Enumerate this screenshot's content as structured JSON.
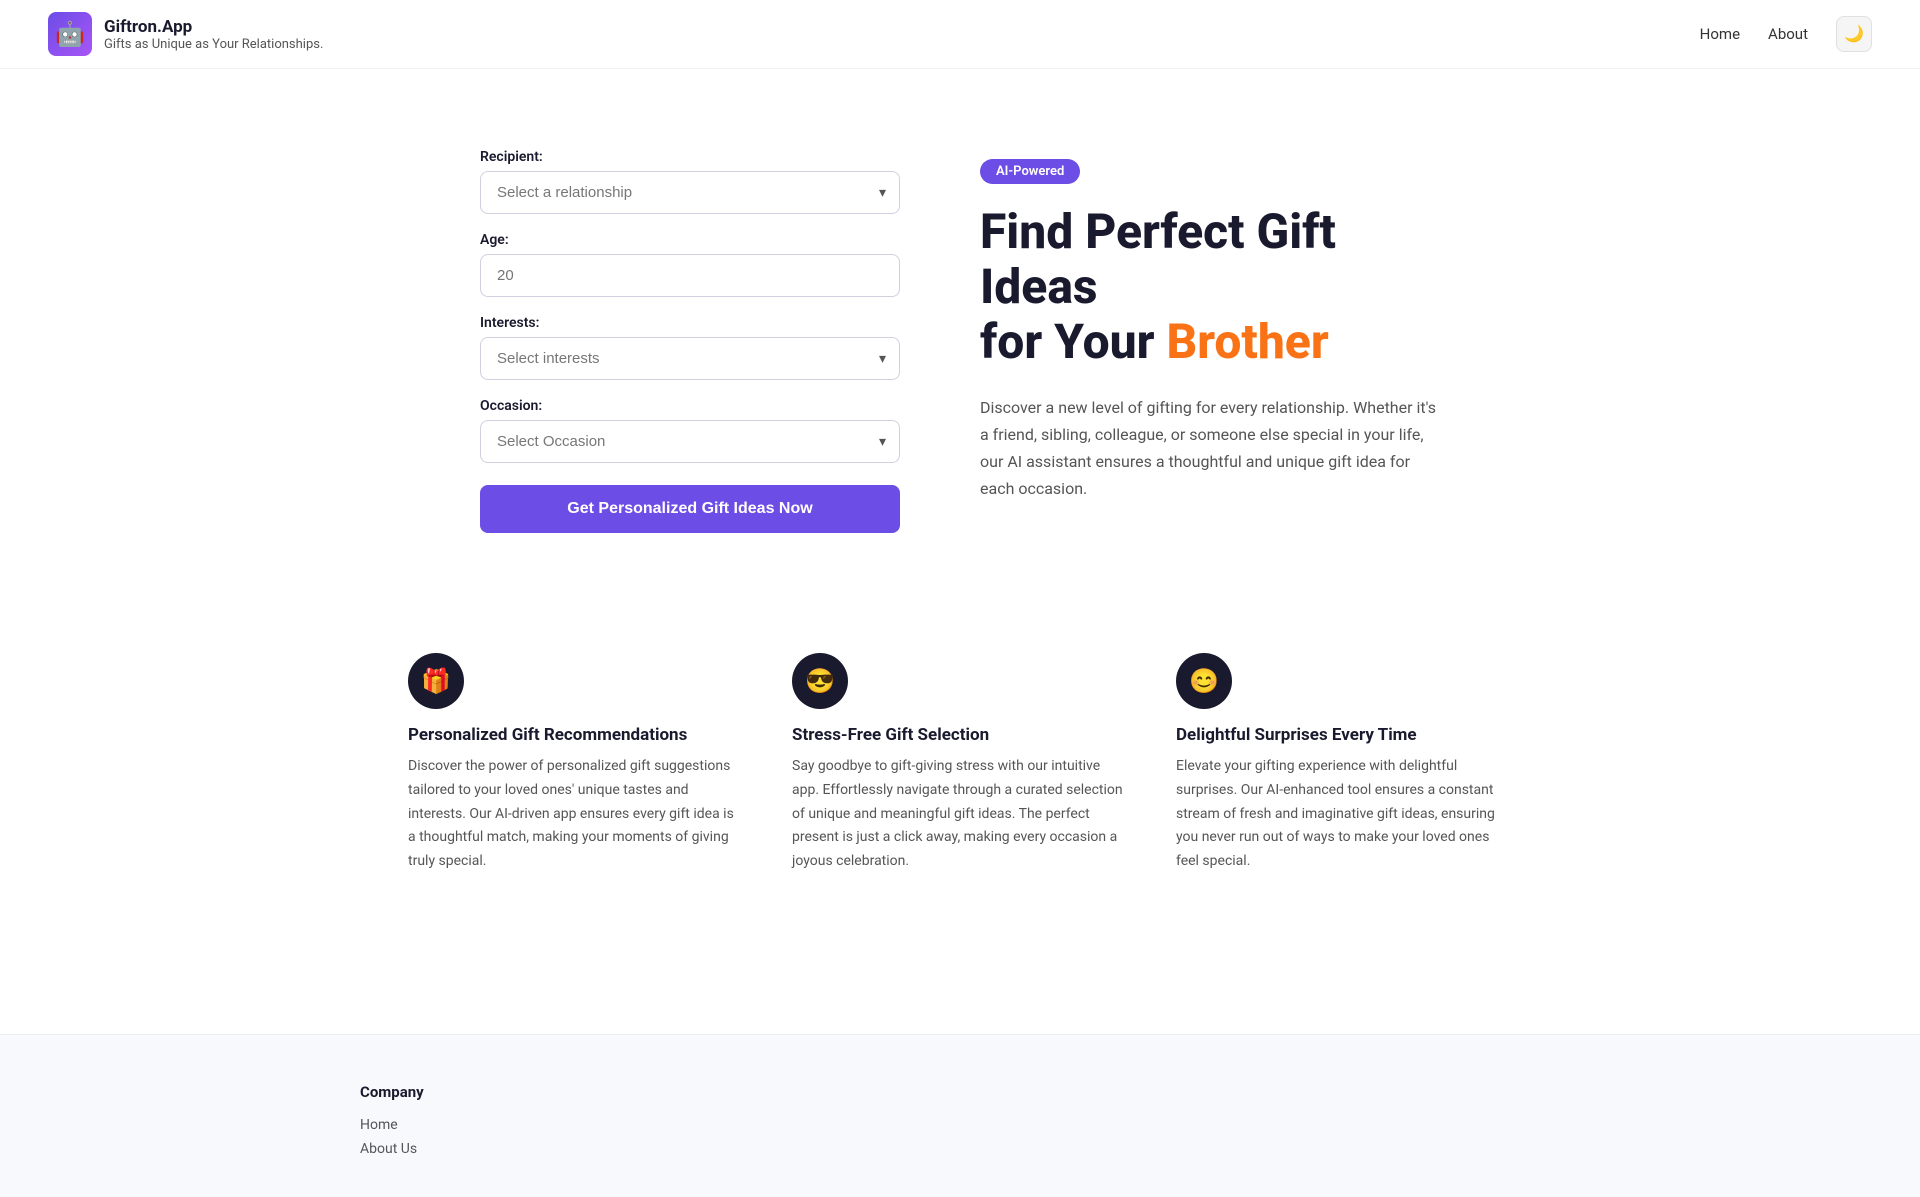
{
  "brand": {
    "logo_emoji": "🤖",
    "title": "Giftron.App",
    "subtitle": "Gifts as Unique as Your Relationships."
  },
  "nav": {
    "home_label": "Home",
    "about_label": "About",
    "theme_icon": "🌙"
  },
  "form": {
    "recipient_label": "Recipient:",
    "recipient_placeholder": "Select a relationship",
    "age_label": "Age:",
    "age_placeholder": "20",
    "interests_label": "Interests:",
    "interests_placeholder": "Select interests",
    "occasion_label": "Occasion:",
    "occasion_placeholder": "Select Occasion",
    "submit_label": "Get Personalized Gift Ideas Now"
  },
  "hero": {
    "badge": "AI-Powered",
    "heading_line1": "Find Perfect Gift Ideas",
    "heading_line2_plain": "for Your ",
    "heading_line2_highlight": "Brother",
    "description": "Discover a new level of gifting for every relationship. Whether it's a friend, sibling, colleague, or someone else special in your life, our AI assistant ensures a thoughtful and unique gift idea for each occasion."
  },
  "features": [
    {
      "icon": "🎁",
      "title": "Personalized Gift Recommendations",
      "description": "Discover the power of personalized gift suggestions tailored to your loved ones' unique tastes and interests. Our AI-driven app ensures every gift idea is a thoughtful match, making your moments of giving truly special."
    },
    {
      "icon": "😎",
      "title": "Stress-Free Gift Selection",
      "description": "Say goodbye to gift-giving stress with our intuitive app. Effortlessly navigate through a curated selection of unique and meaningful gift ideas. The perfect present is just a click away, making every occasion a joyous celebration."
    },
    {
      "icon": "😊",
      "title": "Delightful Surprises Every Time",
      "description": "Elevate your gifting experience with delightful surprises. Our AI-enhanced tool ensures a constant stream of fresh and imaginative gift ideas, ensuring you never run out of ways to make your loved ones feel special."
    }
  ],
  "footer": {
    "company_label": "Company",
    "links": [
      "Home",
      "About Us"
    ]
  }
}
